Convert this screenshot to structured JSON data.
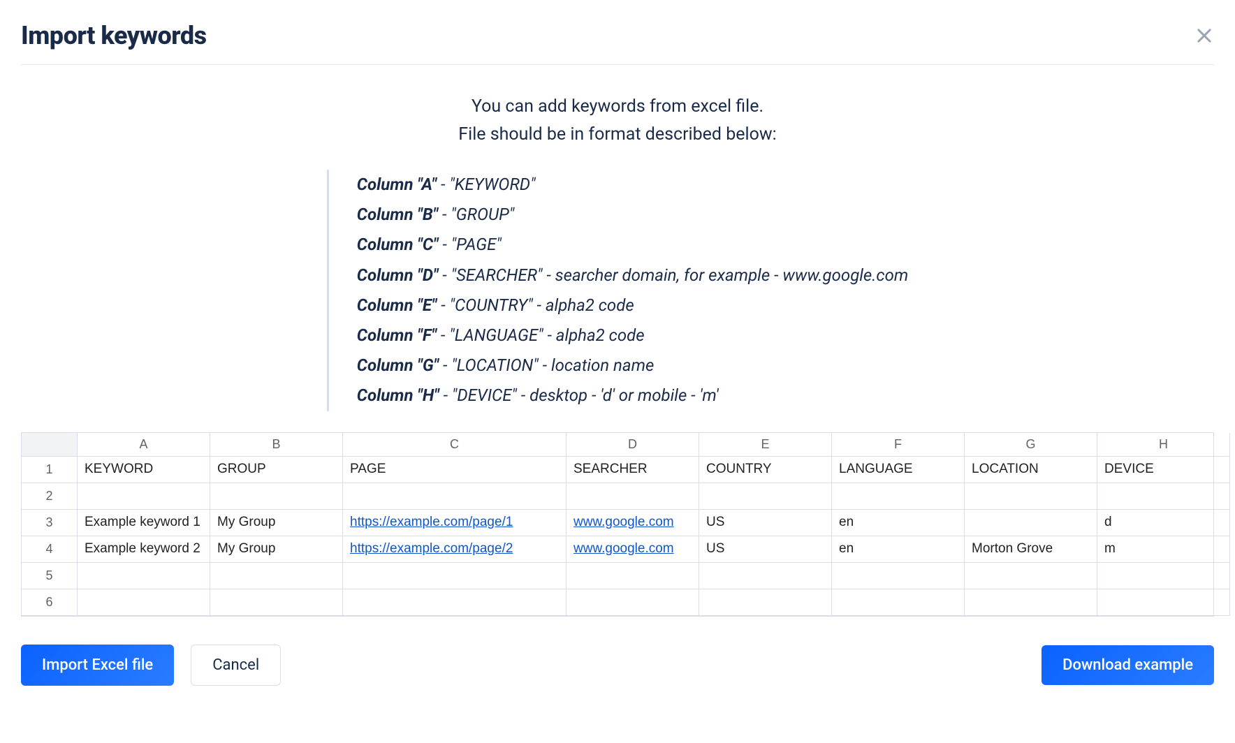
{
  "header": {
    "title": "Import keywords"
  },
  "intro": {
    "line1": "You can add keywords from excel file.",
    "line2": "File should be in format described below:"
  },
  "columns": [
    {
      "col": "Column \"A\"",
      "name": "\"KEYWORD\"",
      "extra": ""
    },
    {
      "col": "Column \"B\"",
      "name": "\"GROUP\"",
      "extra": ""
    },
    {
      "col": "Column \"C\"",
      "name": "\"PAGE\"",
      "extra": ""
    },
    {
      "col": "Column \"D\"",
      "name": "\"SEARCHER\"",
      "extra": " - searcher domain, for example - www.google.com"
    },
    {
      "col": "Column \"E\"",
      "name": "\"COUNTRY\"",
      "extra": " - alpha2 code"
    },
    {
      "col": "Column \"F\"",
      "name": "\"LANGUAGE\"",
      "extra": " - alpha2 code"
    },
    {
      "col": "Column \"G\"",
      "name": "\"LOCATION\"",
      "extra": " - location name"
    },
    {
      "col": "Column \"H\"",
      "name": "\"DEVICE\"",
      "extra": " - desktop - 'd' or mobile - 'm'"
    }
  ],
  "spreadsheet": {
    "col_letters": [
      "A",
      "B",
      "C",
      "D",
      "E",
      "F",
      "G",
      "H"
    ],
    "row_nums": [
      "1",
      "2",
      "3",
      "4",
      "5",
      "6"
    ],
    "headers": [
      "KEYWORD",
      "GROUP",
      "PAGE",
      "SEARCHER",
      "COUNTRY",
      "LANGUAGE",
      "LOCATION",
      "DEVICE"
    ],
    "rows": [
      {
        "keyword": "Example keyword 1",
        "group": "My Group",
        "page": "https://example.com/page/1",
        "searcher": "www.google.com",
        "country": "US",
        "language": "en",
        "location": "",
        "device": "d"
      },
      {
        "keyword": "Example keyword 2",
        "group": "My Group",
        "page": "https://example.com/page/2",
        "searcher": "www.google.com",
        "country": "US",
        "language": "en",
        "location": "Morton Grove",
        "device": "m"
      }
    ]
  },
  "buttons": {
    "import": "Import Excel file",
    "cancel": "Cancel",
    "download": "Download example"
  }
}
